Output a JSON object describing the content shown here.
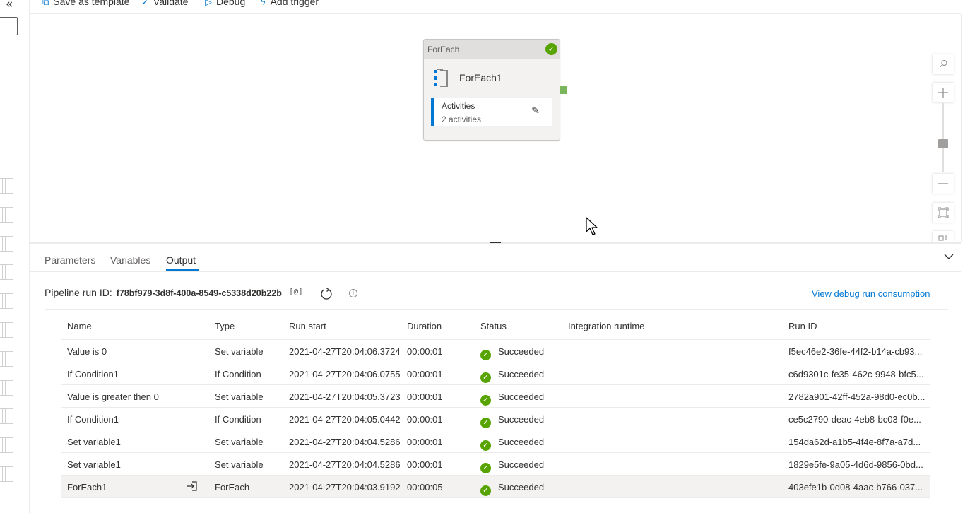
{
  "toolbar": {
    "save_template": "Save as template",
    "validate": "Validate",
    "debug": "Debug",
    "add_trigger": "Add trigger"
  },
  "icons": {
    "collapse": "double-chevron-left-icon",
    "template": "template-icon",
    "validate": "checkmark-icon",
    "debug": "play-icon",
    "trigger": "lightning-icon",
    "pencil": "pencil-icon",
    "search": "search-icon",
    "zoom_in": "plus-icon",
    "zoom_out": "minus-icon",
    "fit": "fit-to-screen-icon",
    "copy": "copy-icon",
    "refresh": "refresh-icon",
    "info": "info-icon",
    "chevron": "chevron-down-icon",
    "goto": "goto-activity-icon"
  },
  "node": {
    "header": "ForEach",
    "name": "ForEach1",
    "activities_label": "Activities",
    "activities_count": "2 activities"
  },
  "tabs": [
    "Parameters",
    "Variables",
    "Output"
  ],
  "active_tab": "Output",
  "run": {
    "label": "Pipeline run ID:",
    "id": "f78bf979-3d8f-400a-8549-c5338d20b22b",
    "copy_glyph": "[@]",
    "consumption_link": "View debug run consumption"
  },
  "table": {
    "columns": [
      "Name",
      "Type",
      "Run start",
      "Duration",
      "Status",
      "Integration runtime",
      "Run ID"
    ],
    "rows": [
      {
        "name": "Value is 0",
        "type": "Set variable",
        "start": "2021-04-27T20:04:06.3724",
        "duration": "00:00:01",
        "status": "Succeeded",
        "ir": "",
        "run_id": "f5ec46e2-36fe-44f2-b14a-cb93..."
      },
      {
        "name": "If Condition1",
        "type": "If Condition",
        "start": "2021-04-27T20:04:06.0755",
        "duration": "00:00:01",
        "status": "Succeeded",
        "ir": "",
        "run_id": "c6d9301c-fe35-462c-9948-bfc5..."
      },
      {
        "name": "Value is greater then 0",
        "type": "Set variable",
        "start": "2021-04-27T20:04:05.3723",
        "duration": "00:00:01",
        "status": "Succeeded",
        "ir": "",
        "run_id": "2782a901-42ff-452a-98d0-ec0b..."
      },
      {
        "name": "If Condition1",
        "type": "If Condition",
        "start": "2021-04-27T20:04:05.0442",
        "duration": "00:00:01",
        "status": "Succeeded",
        "ir": "",
        "run_id": "ce5c2790-deac-4eb8-bc03-f0e..."
      },
      {
        "name": "Set variable1",
        "type": "Set variable",
        "start": "2021-04-27T20:04:04.5286",
        "duration": "00:00:01",
        "status": "Succeeded",
        "ir": "",
        "run_id": "154da62d-a1b5-4f4e-8f7a-a7d..."
      },
      {
        "name": "Set variable1",
        "type": "Set variable",
        "start": "2021-04-27T20:04:04.5286",
        "duration": "00:00:01",
        "status": "Succeeded",
        "ir": "",
        "run_id": "1829e5fe-9a05-4d6d-9856-0bd..."
      },
      {
        "name": "ForEach1",
        "type": "ForEach",
        "start": "2021-04-27T20:04:03.9192",
        "duration": "00:00:05",
        "status": "Succeeded",
        "ir": "",
        "run_id": "403efe1b-0d08-4aac-b766-037..."
      }
    ]
  },
  "colors": {
    "accent": "#0078d4",
    "success": "#57a300",
    "port": "#7ab55c"
  }
}
